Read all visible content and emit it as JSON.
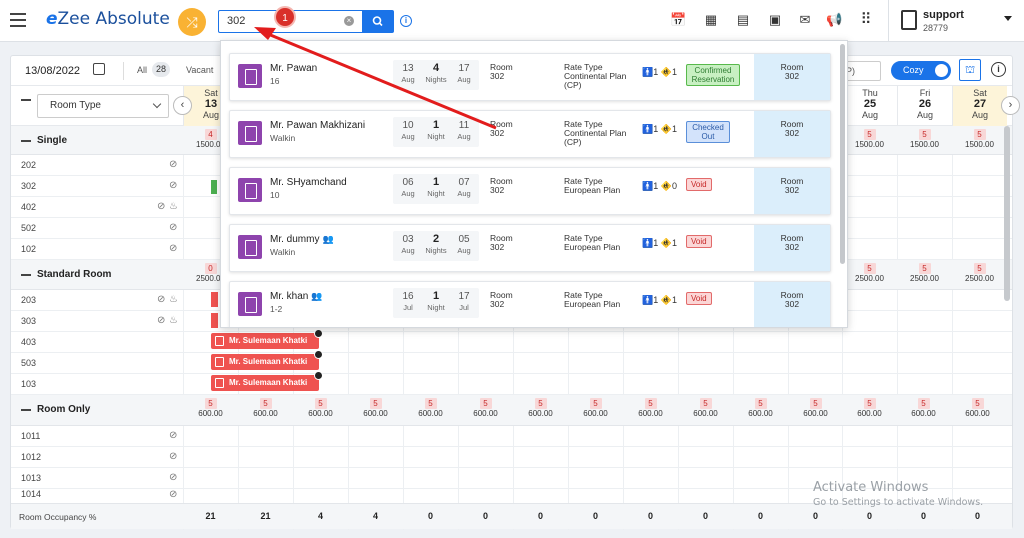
{
  "app": {
    "logo_e": "e",
    "logo_text": "Zee Absolute"
  },
  "search": {
    "value": "302",
    "step": "1"
  },
  "user": {
    "name": "support",
    "id": "28779"
  },
  "toolbar": {
    "date": "13/08/2022",
    "all_label": "All",
    "all_count": "28",
    "vacant_label": "Vacant",
    "plan_dd": "P)",
    "view_mode": "Cozy"
  },
  "roomtype": {
    "label": "Room Type"
  },
  "days": [
    {
      "name": "Sat",
      "date": "13",
      "month": "Aug"
    },
    {
      "name": "Thu",
      "date": "25",
      "month": "Aug"
    },
    {
      "name": "Fri",
      "date": "26",
      "month": "Aug"
    },
    {
      "name": "Sat",
      "date": "27",
      "month": "Aug"
    }
  ],
  "groups": [
    {
      "name": "Single",
      "avail": "4",
      "rate": "1500.00",
      "rooms": [
        "202",
        "302",
        "402",
        "502",
        "102"
      ]
    },
    {
      "name": "Standard Room",
      "avail": "0",
      "rate": "2500.00",
      "rooms": [
        "203",
        "303",
        "403",
        "503",
        "103"
      ]
    },
    {
      "name": "Room Only",
      "rooms": [
        "1011",
        "1012",
        "1013",
        "1014"
      ]
    }
  ],
  "right_avail": {
    "single": [
      {
        "c": "5",
        "r": "1500.00"
      },
      {
        "c": "5",
        "r": "1500.00"
      },
      {
        "c": "5",
        "r": "1500.00"
      }
    ],
    "standard": [
      {
        "c": "5",
        "r": "2500.00"
      },
      {
        "c": "5",
        "r": "2500.00"
      },
      {
        "c": "5",
        "r": "2500.00"
      }
    ]
  },
  "roomonly_avail": {
    "count": "5",
    "rate": "600.00"
  },
  "booking_name": "Mr. Sulemaan Khatki",
  "occupancy": {
    "label": "Room Occupancy %",
    "values": [
      "21",
      "21",
      "4",
      "4",
      "0",
      "0",
      "0",
      "0",
      "0",
      "0",
      "0",
      "0",
      "0",
      "0",
      "0"
    ]
  },
  "results": [
    {
      "name": "Mr. Pawan",
      "sub": "16",
      "group": false,
      "from_d": "13",
      "from_m": "Aug",
      "nights": "4",
      "nights_lbl": "Nights",
      "to_d": "17",
      "to_m": "Aug",
      "room_lbl": "Room",
      "room": "302",
      "rate_lbl": "Rate Type",
      "rate": "Continental Plan (CP)",
      "adults": "1",
      "kids": "1",
      "status": "Confirmed Reservation",
      "status_kind": "confirmed",
      "box_lbl": "Room",
      "box_val": "302"
    },
    {
      "name": "Mr. Pawan Makhizani",
      "sub": "Walkin",
      "group": false,
      "from_d": "10",
      "from_m": "Aug",
      "nights": "1",
      "nights_lbl": "Night",
      "to_d": "11",
      "to_m": "Aug",
      "room_lbl": "Room",
      "room": "302",
      "rate_lbl": "Rate Type",
      "rate": "Continental Plan (CP)",
      "adults": "1",
      "kids": "1",
      "status": "Checked Out",
      "status_kind": "checked",
      "box_lbl": "Room",
      "box_val": "302"
    },
    {
      "name": "Mr. SHyamchand",
      "sub": "10",
      "group": false,
      "from_d": "06",
      "from_m": "Aug",
      "nights": "1",
      "nights_lbl": "Night",
      "to_d": "07",
      "to_m": "Aug",
      "room_lbl": "Room",
      "room": "302",
      "rate_lbl": "Rate Type",
      "rate": "European Plan",
      "adults": "1",
      "kids": "0",
      "status": "Void",
      "status_kind": "void",
      "box_lbl": "Room",
      "box_val": "302"
    },
    {
      "name": "Mr. dummy",
      "sub": "Walkin",
      "group": true,
      "from_d": "03",
      "from_m": "Aug",
      "nights": "2",
      "nights_lbl": "Nights",
      "to_d": "05",
      "to_m": "Aug",
      "room_lbl": "Room",
      "room": "302",
      "rate_lbl": "Rate Type",
      "rate": "European Plan",
      "adults": "1",
      "kids": "1",
      "status": "Void",
      "status_kind": "void",
      "box_lbl": "Room",
      "box_val": "302"
    },
    {
      "name": "Mr. khan",
      "sub": "1-2",
      "group": true,
      "from_d": "16",
      "from_m": "Jul",
      "nights": "1",
      "nights_lbl": "Night",
      "to_d": "17",
      "to_m": "Jul",
      "room_lbl": "Room",
      "room": "302",
      "rate_lbl": "Rate Type",
      "rate": "European Plan",
      "adults": "1",
      "kids": "1",
      "status": "Void",
      "status_kind": "void",
      "box_lbl": "Room",
      "box_val": "302"
    }
  ],
  "watermark": {
    "title": "Activate Windows",
    "sub": "Go to Settings to activate Windows."
  },
  "colors": {
    "accent": "#1a73e8",
    "booking": "#ef5350",
    "shuffle": "#f9b233"
  }
}
